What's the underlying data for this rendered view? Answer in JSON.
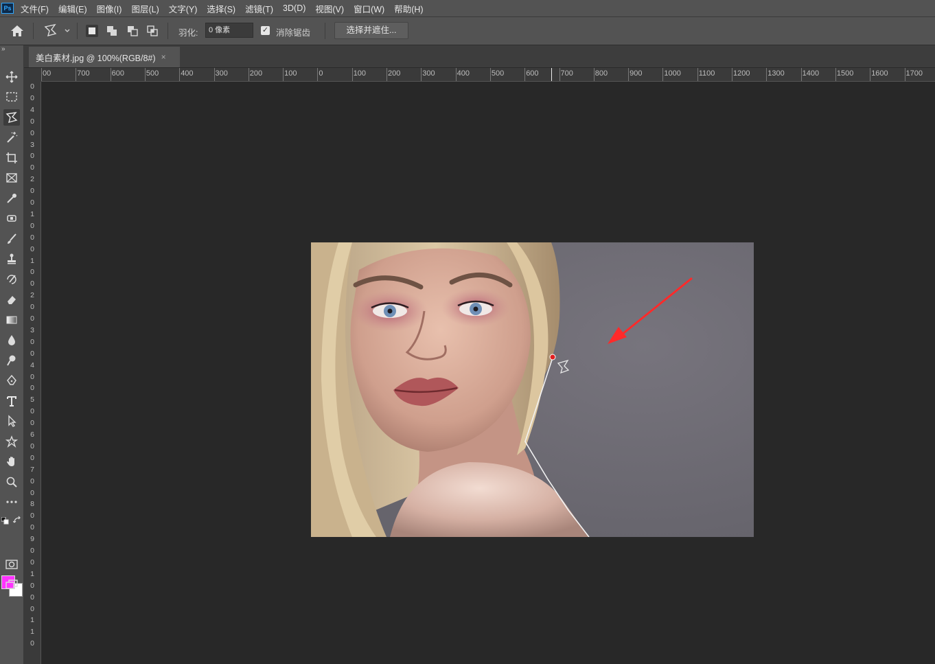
{
  "app": {
    "logo": "Ps"
  },
  "menu": [
    "文件(F)",
    "编辑(E)",
    "图像(I)",
    "图层(L)",
    "文字(Y)",
    "选择(S)",
    "滤镜(T)",
    "3D(D)",
    "视图(V)",
    "窗口(W)",
    "帮助(H)"
  ],
  "options": {
    "feather_label": "羽化:",
    "feather_value": "0 像素",
    "antialias_label": "消除锯齿",
    "antialias_checked": true,
    "select_mask_label": "选择并遮住..."
  },
  "tools": {
    "collapse": "»",
    "active": "polygonal-lasso",
    "foreground_color": "#ff33ff",
    "background_color": "#ffffff"
  },
  "document": {
    "tab_title": "美白素材.jpg @ 100%(RGB/8#)",
    "close": "×"
  },
  "rulers": {
    "horizontal": [
      "00",
      "700",
      "600",
      "500",
      "400",
      "300",
      "200",
      "100",
      "0",
      "100",
      "200",
      "300",
      "400",
      "500",
      "600",
      "700",
      "800",
      "900",
      "1000",
      "1100",
      "1200",
      "1300",
      "1400",
      "1500",
      "1600",
      "1700"
    ],
    "vertical": [
      "0",
      "0",
      "4",
      "0",
      "0",
      "3",
      "0",
      "0",
      "2",
      "0",
      "0",
      "1",
      "0",
      "0",
      "0",
      "1",
      "0",
      "0",
      "2",
      "0",
      "0",
      "3",
      "0",
      "0",
      "4",
      "0",
      "0",
      "5",
      "0",
      "0",
      "6",
      "0",
      "0",
      "7",
      "0",
      "0",
      "8",
      "0",
      "0",
      "9",
      "0",
      "0",
      "1",
      "0",
      "0",
      "0",
      "1",
      "1",
      "0"
    ]
  },
  "colors": {
    "annotation_arrow": "#ff2a2a",
    "anchor_point": "#e02020"
  }
}
